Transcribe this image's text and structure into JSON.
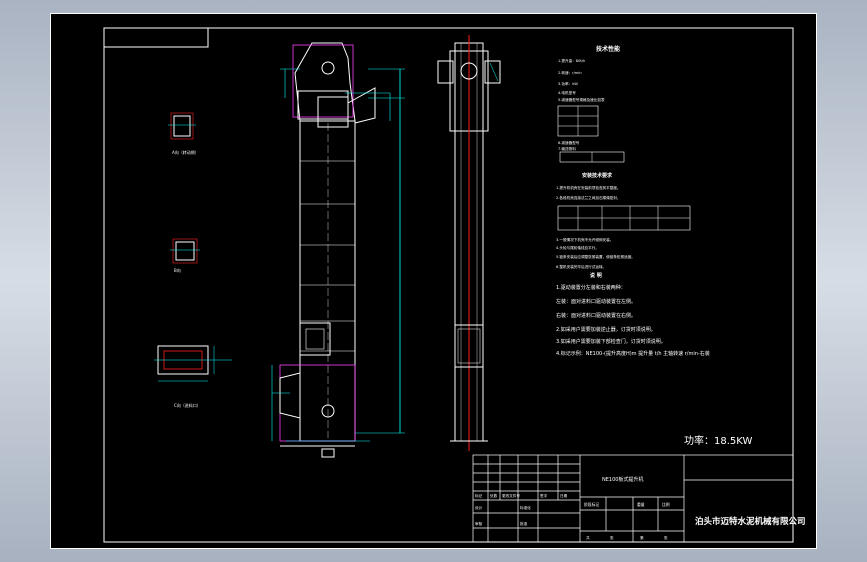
{
  "tech_params": {
    "heading": "技术性能",
    "line1": "1.提升量：80t/h",
    "line2": "2.转速：r/min",
    "line3": "3.功率：kW",
    "line4": "4.电机型号",
    "line5": "5.减速器型号规格及速比如表",
    "line6": "6.减速器型号",
    "line7": "7.输送物料"
  },
  "assembly": {
    "heading": "安装技术要求",
    "req1": "1.提升机机壳在安装前须检查其平整度。",
    "req2": "2.各段机壳连接法兰之间加石棉绳密封。",
    "req3": "3.一般情况下机壳不允许倾斜安装。",
    "req4": "4.头轮与尾轮轴线应平行。",
    "req5": "5.链条安装后应调整张紧装置，使链条松紧适度。",
    "req6": "6.整机安装完毕后进行试运转。"
  },
  "notes": {
    "heading": "说  明",
    "n1": "1.驱动装置分左装和右装两种：",
    "n2": "左装：面对进料口驱动装置在左侧。",
    "n3": "右装：面对进料口驱动装置在右侧。",
    "n4": "2.如采用户需要加装逆止器，订货时须说明。",
    "n5": "3.如采用户需要加装下部检查门，订货时须说明。",
    "n6": "4.标记示例：NE100-(提升高度H)m 提升量 t/h 主轴转速 r/min-右装"
  },
  "power": "功率：18.5KW",
  "title_block": {
    "drawing_title": "NE100板式提升机",
    "company": "泊头市迈特水泥机械有限公司",
    "row1": [
      "标记",
      "处数",
      "更改文件号",
      "签字",
      "日期"
    ],
    "row2": [
      "设计",
      "",
      "标准化",
      ""
    ],
    "row3": [
      "审核",
      "",
      "批准",
      ""
    ],
    "labels": [
      "阶段标记",
      "重量",
      "比例"
    ],
    "sheet": [
      "共",
      "张",
      "第",
      "张"
    ]
  },
  "views": {
    "view_a": "A向（转动侧）",
    "view_b": "B向",
    "view_c": "C向（进料口）"
  },
  "colors": {
    "frame": "#ffffff",
    "cyan": "#00ffff",
    "red": "#ff2020",
    "magenta": "#ff40ff"
  }
}
